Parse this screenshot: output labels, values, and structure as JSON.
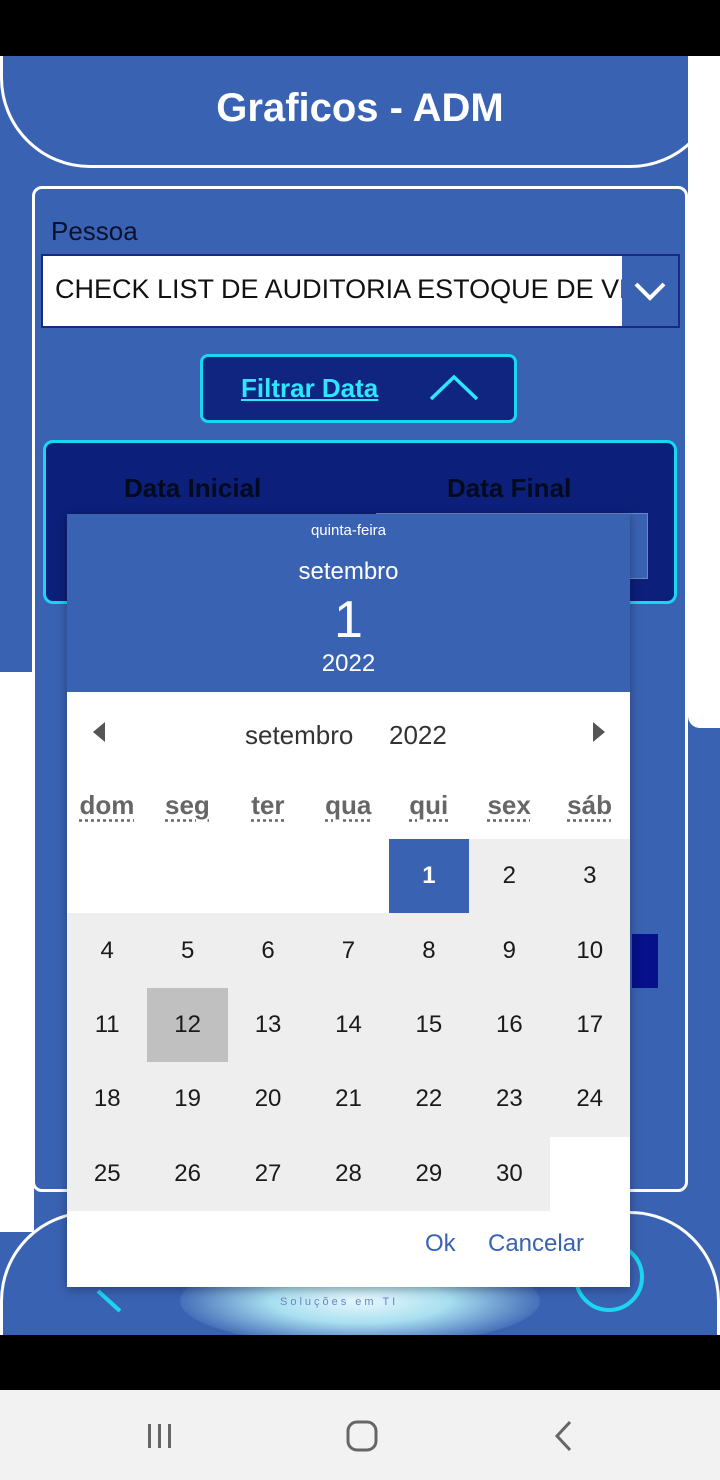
{
  "app": {
    "title": "Graficos - ADM"
  },
  "form": {
    "pessoa_label": "Pessoa",
    "pessoa_value": "CHECK LIST DE AUDITORIA ESTOQUE DE VEÍCULOS",
    "filter_button_label": "Filtrar Data",
    "start_date_label": "Data Inicial",
    "end_date_label": "Data Final"
  },
  "footer": {
    "brand": "Soluções em TI"
  },
  "date_picker": {
    "header": {
      "weekday": "quinta-feira",
      "month": "setembro",
      "day": "1",
      "year": "2022"
    },
    "nav": {
      "month": "setembro",
      "year": "2022"
    },
    "weekdays": [
      "dom",
      "seg",
      "ter",
      "qua",
      "qui",
      "sex",
      "sáb"
    ],
    "first_weekday_index": 4,
    "days_in_month": 30,
    "selected_day": 1,
    "hovered_day": 12,
    "ok_label": "Ok",
    "cancel_label": "Cancelar"
  },
  "colors": {
    "primary": "#3a62b3",
    "accent_cyan": "#1ad6f0",
    "navy": "#0c1f7a"
  }
}
